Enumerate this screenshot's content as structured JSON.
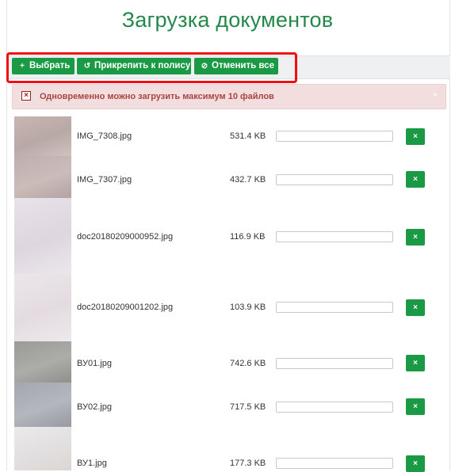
{
  "page": {
    "title": "Загрузка документов"
  },
  "toolbar": {
    "choose": {
      "icon": "plus-icon",
      "glyph": "+",
      "label": "Выбрать"
    },
    "attach": {
      "icon": "attach-icon",
      "glyph": "↺",
      "label": "Прикрепить к полису"
    },
    "cancel_all": {
      "icon": "cancel-icon",
      "glyph": "⊘",
      "label": "Отменить все"
    }
  },
  "alert": {
    "icon": "error-icon",
    "text": "Одновременно можно загрузить максимум 10 файлов",
    "close": "×"
  },
  "files": [
    {
      "name": "IMG_7308.jpg",
      "size": "531.4 KB",
      "progress": 0,
      "remove": "×"
    },
    {
      "name": "IMG_7307.jpg",
      "size": "432.7 KB",
      "progress": 0,
      "remove": "×"
    },
    {
      "name": "doc20180209000952.jpg",
      "size": "116.9 KB",
      "progress": 0,
      "remove": "×"
    },
    {
      "name": "doc20180209001202.jpg",
      "size": "103.9 KB",
      "progress": 0,
      "remove": "×"
    },
    {
      "name": "ВУ01.jpg",
      "size": "742.6 KB",
      "progress": 0,
      "remove": "×"
    },
    {
      "name": "ВУ02.jpg",
      "size": "717.5 KB",
      "progress": 0,
      "remove": "×"
    },
    {
      "name": "ВУ1.jpg",
      "size": "177.3 KB",
      "progress": 0,
      "remove": "×"
    }
  ],
  "colors": {
    "accent": "#1a9a45",
    "title": "#23884a",
    "highlight": "#ef0f12",
    "alert_bg": "#f2dede",
    "alert_text": "#a94442"
  }
}
